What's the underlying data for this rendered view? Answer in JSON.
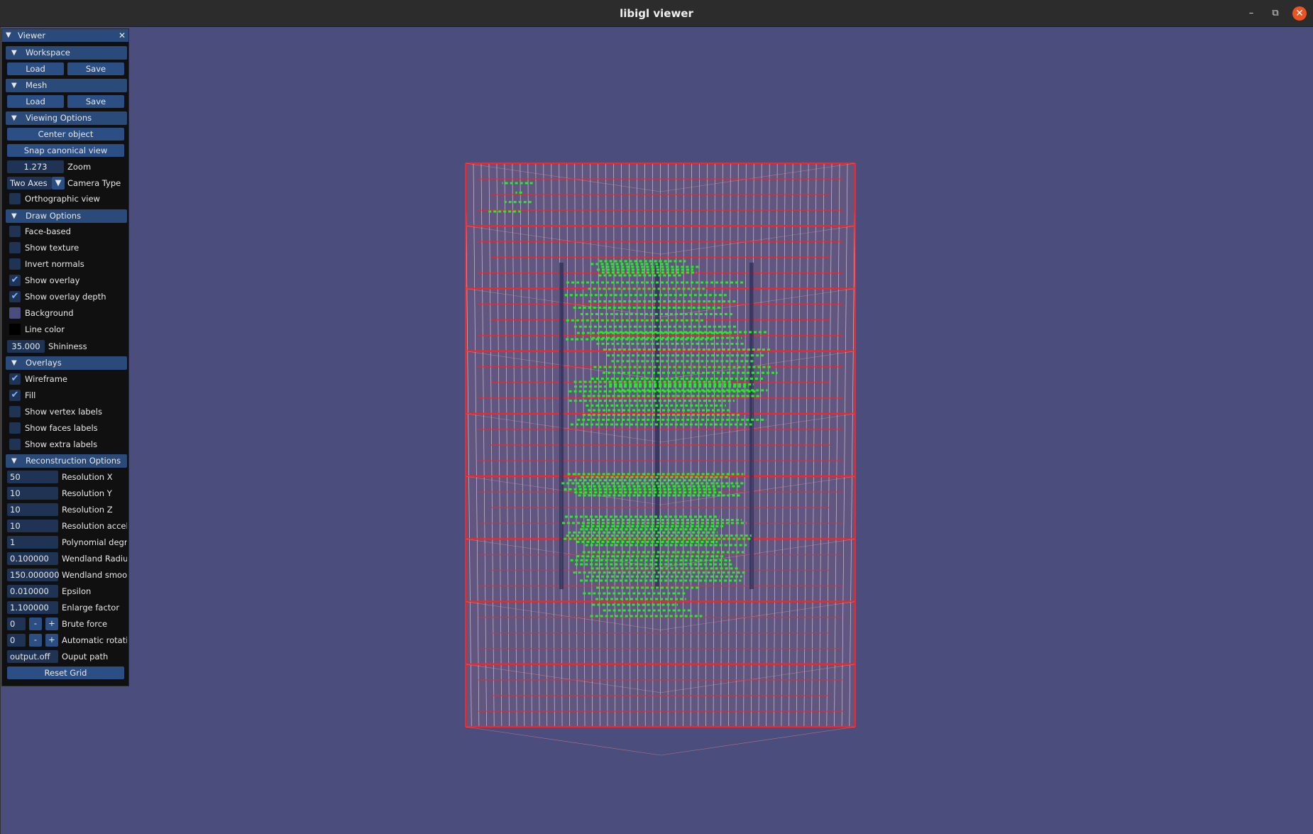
{
  "window": {
    "title": "libigl viewer",
    "minimize": "–",
    "restore": "⧉",
    "close": "✕"
  },
  "panel": {
    "title": "Viewer",
    "collapse_icon": "▼",
    "close_icon": "✕"
  },
  "workspace": {
    "header": "Workspace",
    "load": "Load",
    "save": "Save"
  },
  "mesh": {
    "header": "Mesh",
    "load": "Load",
    "save": "Save"
  },
  "viewing": {
    "header": "Viewing Options",
    "center": "Center object",
    "snap": "Snap canonical view",
    "zoom_value": "1.273",
    "zoom_label": "Zoom",
    "camera_value": "Two Axes",
    "camera_label": "Camera Type",
    "camera_arrow": "▼",
    "ortho_label": "Orthographic view",
    "ortho_checked": false
  },
  "draw": {
    "header": "Draw Options",
    "items": [
      {
        "label": "Face-based",
        "checked": false
      },
      {
        "label": "Show texture",
        "checked": false
      },
      {
        "label": "Invert normals",
        "checked": false
      },
      {
        "label": "Show overlay",
        "checked": true
      },
      {
        "label": "Show overlay depth",
        "checked": true
      }
    ],
    "background_label": "Background",
    "background_color": "#4b4d7c",
    "linecolor_label": "Line color",
    "linecolor_color": "#000000",
    "shininess_value": "35.000",
    "shininess_label": "Shininess"
  },
  "overlays": {
    "header": "Overlays",
    "items": [
      {
        "label": "Wireframe",
        "checked": true
      },
      {
        "label": "Fill",
        "checked": true
      },
      {
        "label": "Show vertex labels",
        "checked": false
      },
      {
        "label": "Show faces labels",
        "checked": false
      },
      {
        "label": "Show extra labels",
        "checked": false
      }
    ]
  },
  "recon": {
    "header": "Reconstruction Options",
    "fields": [
      {
        "value": "50",
        "label": "Resolution X"
      },
      {
        "value": "10",
        "label": "Resolution Y"
      },
      {
        "value": "10",
        "label": "Resolution Z"
      },
      {
        "value": "10",
        "label": "Resolution acceler"
      },
      {
        "value": "1",
        "label": "Polynomial degree"
      },
      {
        "value": "0.100000",
        "label": "Wendland Radius"
      },
      {
        "value": "150.000000",
        "label": "Wendland smooth"
      },
      {
        "value": "0.010000",
        "label": "Epsilon"
      },
      {
        "value": "1.100000",
        "label": "Enlarge factor"
      }
    ],
    "brute_value": "0",
    "brute_label": "Brute force",
    "auto_value": "0",
    "auto_label": "Automatic rotatior",
    "minus": "-",
    "plus": "+",
    "output_value": "output.off",
    "output_label": "Ouput path",
    "reset": "Reset Grid"
  },
  "colors": {
    "grid": "#ff2222",
    "fill": "#ff9a9a",
    "points": "#22ee22",
    "wire": "#d8d8e8"
  }
}
